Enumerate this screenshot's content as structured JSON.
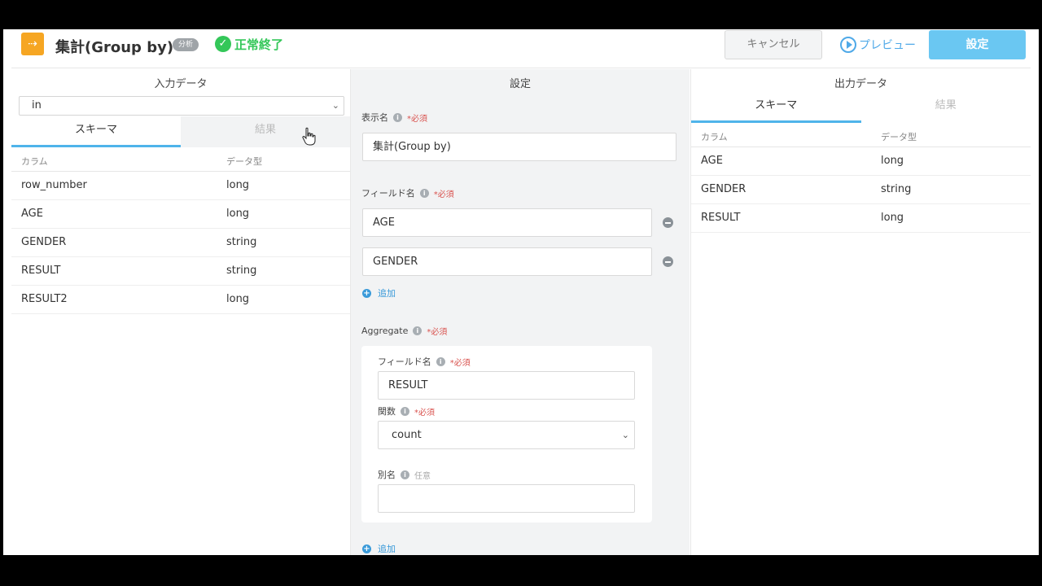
{
  "header": {
    "logo_glyph": "⇢",
    "title": "集計(Group by)",
    "badge": "分析",
    "status": "正常終了",
    "cancel_label": "キャンセル",
    "preview_label": "プレビュー",
    "settings_label": "設定"
  },
  "input_panel": {
    "title": "入力データ",
    "source": "in",
    "tabs": [
      "スキーマ",
      "結果"
    ],
    "columns": [
      "カラム",
      "データ型"
    ],
    "rows": [
      [
        "row_number",
        "long"
      ],
      [
        "AGE",
        "long"
      ],
      [
        "GENDER",
        "string"
      ],
      [
        "RESULT",
        "string"
      ],
      [
        "RESULT2",
        "long"
      ]
    ]
  },
  "settings_panel": {
    "title": "設定",
    "display_name_label": "表示名",
    "required": "*必須",
    "optional": "任意",
    "display_name_value": "集計(Group by)",
    "field_name_label": "フィールド名",
    "fields": [
      "AGE",
      "GENDER"
    ],
    "add_label": "追加",
    "aggregate_label": "Aggregate",
    "agg_field_label": "フィールド名",
    "agg_field_value": "RESULT",
    "function_label": "関数",
    "function_value": "count",
    "alias_label": "別名",
    "alias_value": ""
  },
  "output_panel": {
    "title": "出力データ",
    "tabs": [
      "スキーマ",
      "結果"
    ],
    "columns": [
      "カラム",
      "データ型"
    ],
    "rows": [
      [
        "AGE",
        "long"
      ],
      [
        "GENDER",
        "string"
      ],
      [
        "RESULT",
        "long"
      ]
    ]
  },
  "colors": {
    "accent": "#4fb4ea",
    "success": "#34c759",
    "logo": "#f6a623",
    "required": "#d9534f"
  }
}
